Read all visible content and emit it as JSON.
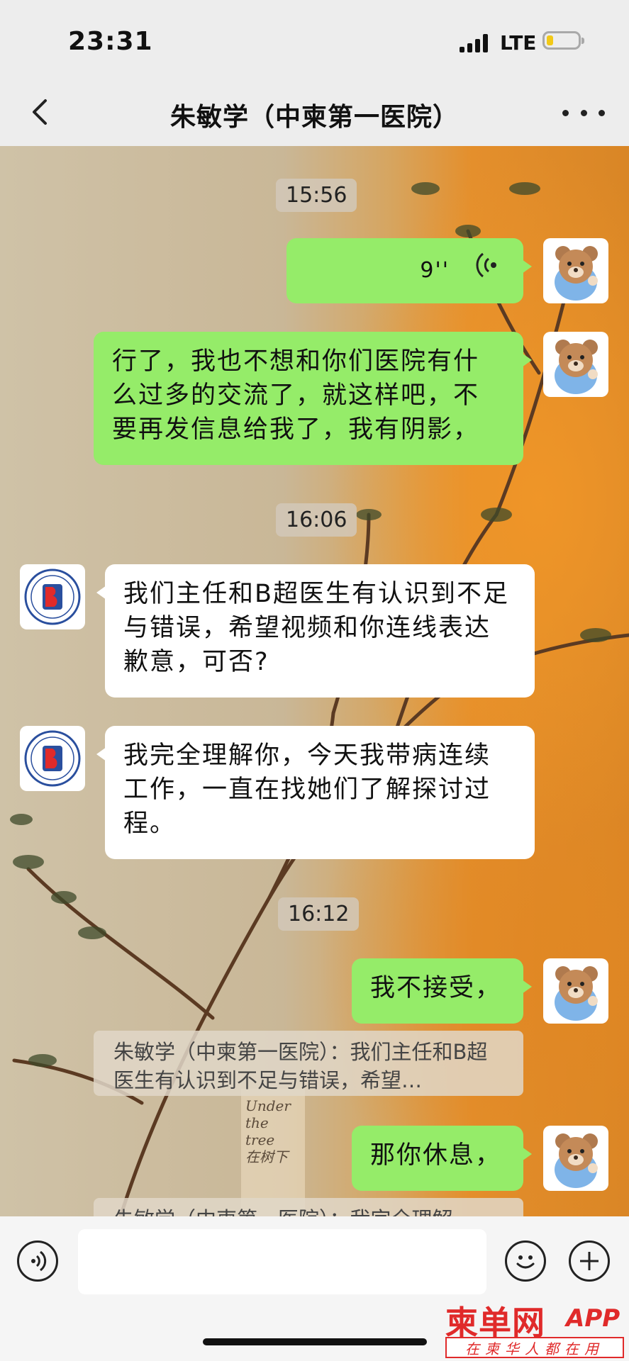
{
  "status_bar": {
    "time": "23:31",
    "network": "LTE"
  },
  "nav": {
    "title": "朱敏学（中柬第一医院）"
  },
  "messages": [
    {
      "type": "timestamp",
      "text": "15:56"
    },
    {
      "type": "voice",
      "side": "right",
      "duration": "9''"
    },
    {
      "type": "text",
      "side": "right",
      "text": "行了，我也不想和你们医院有什么过多的交流了，就这样吧，不要再发信息给我了，我有阴影，"
    },
    {
      "type": "timestamp",
      "text": "16:06"
    },
    {
      "type": "text",
      "side": "left",
      "text": "我们主任和B超医生有认识到不足与错误，希望视频和你连线表达歉意，可否?"
    },
    {
      "type": "text",
      "side": "left",
      "text": "我完全理解你，今天我带病连续工作，一直在找她们了解探讨过程。"
    },
    {
      "type": "timestamp",
      "text": "16:12"
    },
    {
      "type": "text",
      "side": "right",
      "text": "我不接受，"
    },
    {
      "type": "quote",
      "text": "朱敏学（中柬第一医院）：我们主任和B超医生有认识到不足与错误，希望…"
    },
    {
      "type": "text",
      "side": "right",
      "text": "那你休息，"
    },
    {
      "type": "quote",
      "text": "朱敏学（中柬第一医院）：我完全理解"
    }
  ],
  "wallpaper_sign": [
    "Under",
    "the tree",
    "在树下"
  ],
  "watermark": {
    "logo": "柬单网",
    "app": "APP",
    "slogan": "在柬华人都在用"
  },
  "colors": {
    "sent_bubble": "#95ec69",
    "received_bubble": "#ffffff",
    "bar_bg": "#ededed"
  },
  "icons": {
    "back": "chevron-left-icon",
    "more": "more-dots-icon",
    "voice": "voice-mode-icon",
    "emoji": "emoji-icon",
    "plus": "plus-icon"
  }
}
